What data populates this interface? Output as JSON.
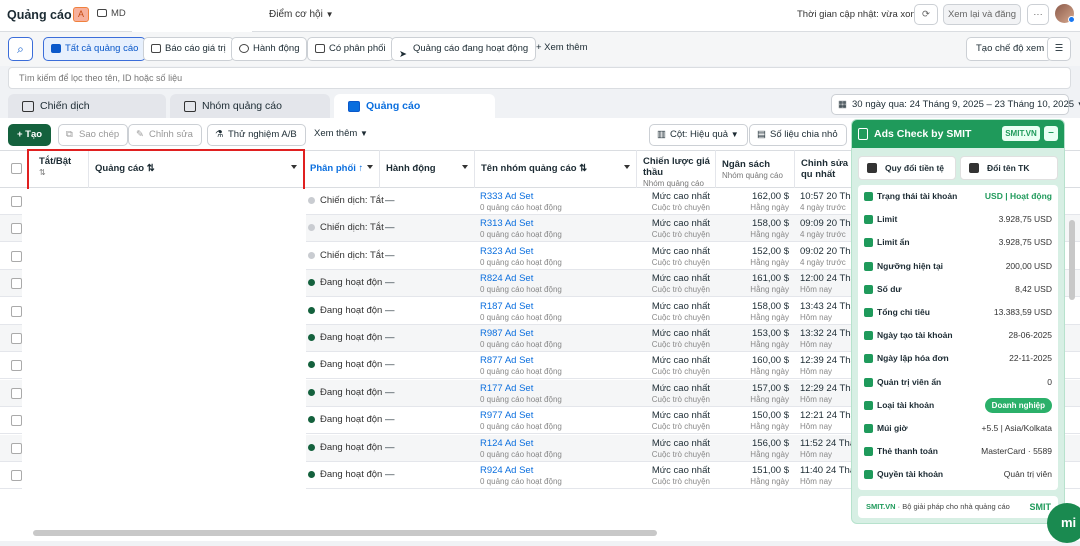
{
  "topbar": {
    "title": "Quảng cáo",
    "account_letter": "A",
    "account_short": "MD",
    "opportunity": "Điểm cơ hội",
    "updated": "Thời gian cập nhật: vừa xong",
    "review_btn": "Xem lại và đăng",
    "more_btn": "···"
  },
  "filters": {
    "all_ads": "Tất cả quảng cáo",
    "value_report": "Báo cáo giá trị",
    "actions": "Hành động",
    "has_delivery": "Có phân phối",
    "active_ads": "Quảng cáo đang hoạt động",
    "see_more": "+  Xem thêm",
    "create_view": "Tạo chế độ xem"
  },
  "search": {
    "placeholder": "Tìm kiếm để lọc theo tên, ID hoặc số liệu"
  },
  "tabs": [
    {
      "label": "Chiến dịch"
    },
    {
      "label": "Nhóm quảng cáo"
    },
    {
      "label": "Quảng cáo"
    }
  ],
  "daterange": "30 ngày qua: 24 Tháng 9, 2025 – 23 Tháng 10, 2025",
  "actions": {
    "create": "+  Tạo",
    "copy": "Sao chép",
    "edit": "Chỉnh sửa",
    "ab_test": "Thử nghiệm A/B",
    "see_more": "Xem thêm",
    "columns": "Cột: Hiệu quả",
    "breakdown": "Số liệu chia nhỏ"
  },
  "headers": {
    "toggle": "Tắt/Bật",
    "toggle_sort": "⇅",
    "ad": "Quảng cáo ⇅",
    "delivery": "Phân phối ↑",
    "actions": "Hành động",
    "adset": "Tên nhóm quảng cáo ⇅",
    "bid": "Chiến lược giá thầu",
    "bid_sub": "Nhóm quảng cáo",
    "budget": "Ngân sách",
    "budget_sub": "Nhóm quảng cáo",
    "edited": "Chỉnh sửa qu nhất"
  },
  "rows": [
    {
      "status": "Chiến dịch: Tắt",
      "active": false,
      "action": "—",
      "adset": "R333 Ad Set",
      "adset_sub": "0 quảng cáo hoạt động",
      "bid": "Mức cao nhất",
      "bid_sub": "Cuộc trò chuyện",
      "budget": "162,00 $",
      "budget_sub": "Hằng ngày",
      "edited": "10:57 20 Thán",
      "edited_sub": "4 ngày trước"
    },
    {
      "status": "Chiến dịch: Tắt",
      "active": false,
      "action": "—",
      "adset": "R313 Ad Set",
      "adset_sub": "0 quảng cáo hoạt động",
      "bid": "Mức cao nhất",
      "bid_sub": "Cuộc trò chuyện",
      "budget": "158,00 $",
      "budget_sub": "Hằng ngày",
      "edited": "09:09 20 Thán",
      "edited_sub": "4 ngày trước"
    },
    {
      "status": "Chiến dịch: Tắt",
      "active": false,
      "action": "—",
      "adset": "R323 Ad Set",
      "adset_sub": "0 quảng cáo hoạt động",
      "bid": "Mức cao nhất",
      "bid_sub": "Cuộc trò chuyện",
      "budget": "152,00 $",
      "budget_sub": "Hằng ngày",
      "edited": "09:02 20 Thán",
      "edited_sub": "4 ngày trước"
    },
    {
      "status": "Đang hoạt độn",
      "active": true,
      "action": "—",
      "adset": "R824 Ad Set",
      "adset_sub": "0 quảng cáo hoạt động",
      "bid": "Mức cao nhất",
      "bid_sub": "Cuộc trò chuyện",
      "budget": "161,00 $",
      "budget_sub": "Hằng ngày",
      "edited": "12:00 24 Thán",
      "edited_sub": "Hôm nay"
    },
    {
      "status": "Đang hoạt độn",
      "active": true,
      "action": "—",
      "adset": "R187 Ad Set",
      "adset_sub": "0 quảng cáo hoạt động",
      "bid": "Mức cao nhất",
      "bid_sub": "Cuộc trò chuyện",
      "budget": "158,00 $",
      "budget_sub": "Hằng ngày",
      "edited": "13:43 24 Thán",
      "edited_sub": "Hôm nay"
    },
    {
      "status": "Đang hoạt độn",
      "active": true,
      "action": "—",
      "adset": "R987 Ad Set",
      "adset_sub": "0 quảng cáo hoạt động",
      "bid": "Mức cao nhất",
      "bid_sub": "Cuộc trò chuyện",
      "budget": "153,00 $",
      "budget_sub": "Hằng ngày",
      "edited": "13:32 24 Thán",
      "edited_sub": "Hôm nay"
    },
    {
      "status": "Đang hoạt độn",
      "active": true,
      "action": "—",
      "adset": "R877 Ad Set",
      "adset_sub": "0 quảng cáo hoạt động",
      "bid": "Mức cao nhất",
      "bid_sub": "Cuộc trò chuyện",
      "budget": "160,00 $",
      "budget_sub": "Hằng ngày",
      "edited": "12:39 24 Thán",
      "edited_sub": "Hôm nay"
    },
    {
      "status": "Đang hoạt độn",
      "active": true,
      "action": "—",
      "adset": "R177 Ad Set",
      "adset_sub": "0 quảng cáo hoạt động",
      "bid": "Mức cao nhất",
      "bid_sub": "Cuộc trò chuyện",
      "budget": "157,00 $",
      "budget_sub": "Hằng ngày",
      "edited": "12:29 24 Thán",
      "edited_sub": "Hôm nay"
    },
    {
      "status": "Đang hoạt độn",
      "active": true,
      "action": "—",
      "adset": "R977 Ad Set",
      "adset_sub": "0 quảng cáo hoạt động",
      "bid": "Mức cao nhất",
      "bid_sub": "Cuộc trò chuyện",
      "budget": "150,00 $",
      "budget_sub": "Hằng ngày",
      "edited": "12:21 24 Thán",
      "edited_sub": "Hôm nay"
    },
    {
      "status": "Đang hoạt độn",
      "active": true,
      "action": "—",
      "adset": "R124 Ad Set",
      "adset_sub": "0 quảng cáo hoạt động",
      "bid": "Mức cao nhất",
      "bid_sub": "Cuộc trò chuyện",
      "budget": "156,00 $",
      "budget_sub": "Hằng ngày",
      "edited": "11:52 24 Thán",
      "edited_sub": "Hôm nay"
    },
    {
      "status": "Đang hoạt độn",
      "active": true,
      "action": "—",
      "adset": "R924 Ad Set",
      "adset_sub": "0 quảng cáo hoạt động",
      "bid": "Mức cao nhất",
      "bid_sub": "Cuộc trò chuyện",
      "budget": "151,00 $",
      "budget_sub": "Hằng ngày",
      "edited": "11:40 24 Thán",
      "edited_sub": "Hôm nay"
    }
  ],
  "panel": {
    "title": "Ads Check by SMIT",
    "brand": "SMIT.VN",
    "minimize": "–",
    "convert_btn": "Quy đổi tiền tệ",
    "rename_btn": "Đổi tên TK",
    "items": [
      {
        "label": "Trạng thái tài khoản",
        "value": "USD | Hoạt động",
        "style": "green"
      },
      {
        "label": "Limit",
        "value": "3.928,75 USD"
      },
      {
        "label": "Limit ẩn",
        "value": "3.928,75 USD"
      },
      {
        "label": "Ngưỡng hiện tại",
        "value": "200,00 USD"
      },
      {
        "label": "Số dư",
        "value": "8,42 USD"
      },
      {
        "label": "Tổng chi tiêu",
        "value": "13.383,59 USD"
      },
      {
        "label": "Ngày tạo tài khoản",
        "value": "28-06-2025"
      },
      {
        "label": "Ngày lập hóa đơn",
        "value": "22-11-2025"
      },
      {
        "label": "Quản trị viên ẩn",
        "value": "0"
      },
      {
        "label": "Loại tài khoản",
        "value": "Doanh nghiệp",
        "style": "badge"
      },
      {
        "label": "Múi giờ",
        "value": "+5.5 | Asia/Kolkata"
      },
      {
        "label": "Thẻ thanh toán",
        "value": "MasterCard · 5589"
      },
      {
        "label": "Quyền tài khoản",
        "value": "Quản trị viên"
      }
    ],
    "footer_brand": "SMIT.VN",
    "footer_text": " · Bộ giải pháp cho nhà quảng cáo",
    "footer_logo": "SMIT"
  },
  "fab": "mi"
}
